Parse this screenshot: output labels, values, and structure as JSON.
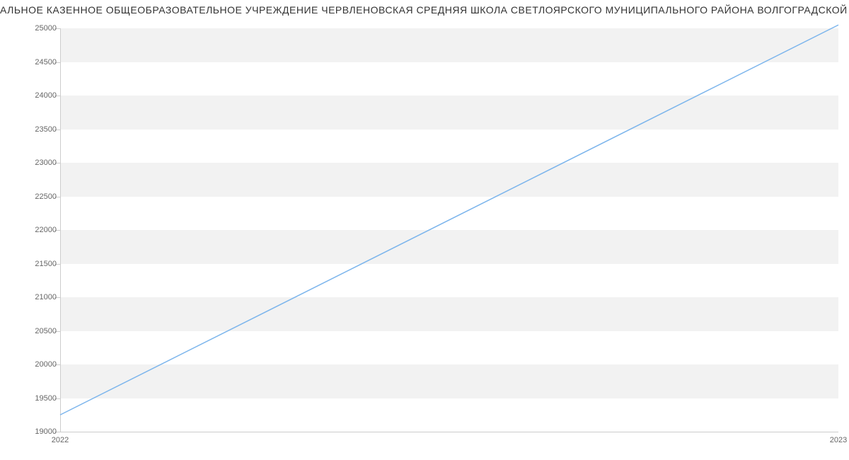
{
  "chart_data": {
    "type": "line",
    "title": "АЛЬНОЕ КАЗЕННОЕ ОБЩЕОБРАЗОВАТЕЛЬНОЕ УЧРЕЖДЕНИЕ ЧЕРВЛЕНОВСКАЯ СРЕДНЯЯ ШКОЛА СВЕТЛОЯРСКОГО МУНИЦИПАЛЬНОГО РАЙОНА ВОЛГОГРАДСКОЙ ОБЛАСТИ",
    "categories": [
      "2022",
      "2023"
    ],
    "series": [
      {
        "name": "value",
        "values": [
          19250,
          25050
        ]
      }
    ],
    "xlabel": "",
    "ylabel": "",
    "ylim": [
      19000,
      25000
    ],
    "y_ticks": [
      19000,
      19500,
      20000,
      20500,
      21000,
      21500,
      22000,
      22500,
      23000,
      23500,
      24000,
      24500,
      25000
    ],
    "line_color": "#7cb5ec"
  }
}
